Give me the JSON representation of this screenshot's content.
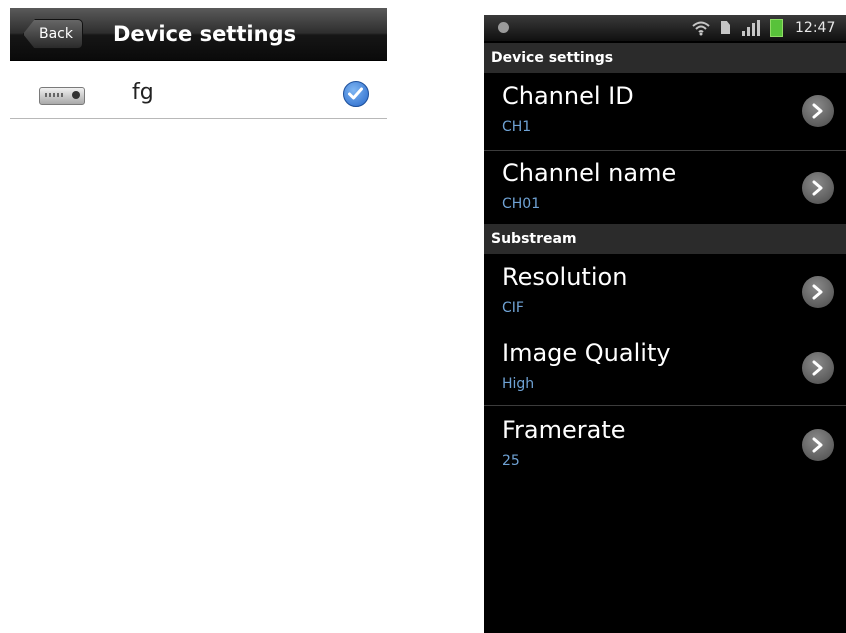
{
  "left": {
    "back_label": "Back",
    "title": "Device settings",
    "device": {
      "name": "fg",
      "selected": true
    }
  },
  "right": {
    "status": {
      "time": "12:47"
    },
    "sections": {
      "device_settings": "Device settings",
      "substream": "Substream"
    },
    "items": {
      "channel_id": {
        "label": "Channel ID",
        "value": "CH1"
      },
      "channel_name": {
        "label": "Channel name",
        "value": "CH01"
      },
      "resolution": {
        "label": "Resolution",
        "value": "CIF"
      },
      "image_quality": {
        "label": "Image Quality",
        "value": "High"
      },
      "framerate": {
        "label": "Framerate",
        "value": "25"
      }
    }
  },
  "colors": {
    "accent_value": "#6fa2d4",
    "check_blue": "#2667c9"
  },
  "icons": [
    "device-icon",
    "check-icon",
    "notification-icon",
    "wifi-icon",
    "sim-icon",
    "signal-icon",
    "battery-icon",
    "chevron-right-icon"
  ]
}
